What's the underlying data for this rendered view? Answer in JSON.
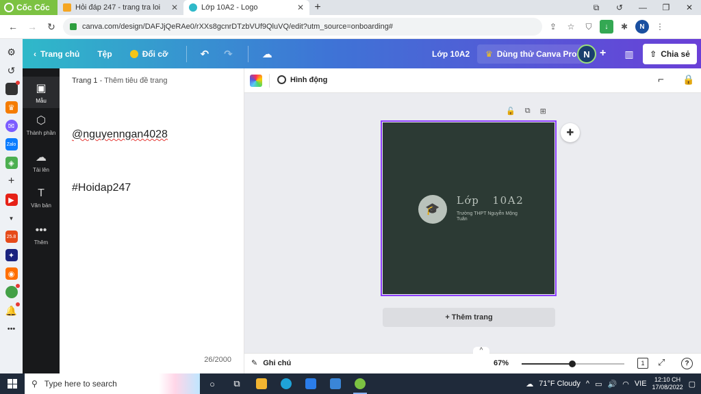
{
  "browser": {
    "brand": "Cốc Cốc",
    "tabs": [
      {
        "title": "Hỏi đáp 247 - trang tra loi",
        "favicon_color": "#f5a623"
      },
      {
        "title": "Lớp 10A2 - Logo",
        "favicon_color": "#2fb9c9"
      }
    ],
    "new_tab": "+",
    "url": "canva.com/design/DAFJjQeRAe0/rXXs8gcnrDTzbVUf9QluVQ/edit?utm_source=onboarding#",
    "profile_initial": "N"
  },
  "canva": {
    "header": {
      "home": "Trang chủ",
      "file": "Tệp",
      "resize": "Đổi cỡ",
      "doc_name": "Lớp 10A2",
      "try_pro": "Dùng thử Canva Pro",
      "avatar_initial": "N",
      "share": "Chia sẻ"
    },
    "nav": [
      {
        "label": "Mẫu",
        "glyph": "▣"
      },
      {
        "label": "Thành phần",
        "glyph": "⬡"
      },
      {
        "label": "Tải lên",
        "glyph": "☁"
      },
      {
        "label": "Văn bản",
        "glyph": "T"
      },
      {
        "label": "Thêm",
        "glyph": "•••"
      }
    ],
    "panel": {
      "page_label": "Trang 1",
      "page_title_placeholder": "Thêm tiêu đề trang",
      "note_line1": "@nguyenngan4028",
      "note_line2": "#Hoidap247",
      "char_count": "26/2000"
    },
    "toolbar": {
      "animate": "Hình động"
    },
    "design": {
      "title": "Lớp   10A2",
      "subtitle": "Trường THPT Nguyễn Mộng Tuân",
      "background_color": "#2c3a34",
      "accent_color": "#b9c2bb",
      "selection_color": "#8b3dff"
    },
    "add_page": "+ Thêm trang",
    "bottom": {
      "notes": "Ghi chú",
      "zoom": "67%",
      "zoom_fraction": 0.49,
      "page_number": "1",
      "help": "?"
    }
  },
  "taskbar": {
    "search_placeholder": "Type here to search",
    "weather": "71°F  Cloudy",
    "lang": "VIE",
    "time": "12:10 CH",
    "date": "17/08/2022"
  }
}
